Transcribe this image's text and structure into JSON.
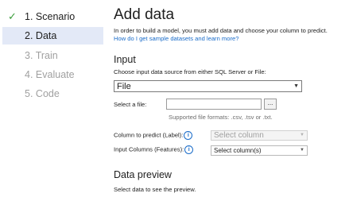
{
  "steps": [
    {
      "number": "1.",
      "label": "Scenario",
      "state": "done",
      "check": "✓"
    },
    {
      "number": "2.",
      "label": "Data",
      "state": "active"
    },
    {
      "number": "3.",
      "label": "Train",
      "state": "disabled"
    },
    {
      "number": "4.",
      "label": "Evaluate",
      "state": "disabled"
    },
    {
      "number": "5.",
      "label": "Code",
      "state": "disabled"
    }
  ],
  "main": {
    "title": "Add data",
    "intro_text": "In order to build a model, you must add data and choose your column to predict.",
    "intro_link": "How do I get sample datasets and learn more?",
    "input_heading": "Input",
    "source_label": "Choose input data source from either SQL Server or File:",
    "source_value": "File",
    "file_label": "Select a file:",
    "file_value": "",
    "browse_label": "...",
    "supported_formats": "Supported file formats: .csv, .tsv or .txt.",
    "label_column_label": "Column to predict (Label):",
    "label_column_value": "Select column",
    "features_label": "Input Columns (Features):",
    "features_value": "Select column(s)",
    "preview_heading": "Data preview",
    "preview_text": "Select data to see the preview."
  },
  "icons": {
    "check": "check-icon",
    "info": "info-icon",
    "dropdown": "chevron-down-icon"
  }
}
